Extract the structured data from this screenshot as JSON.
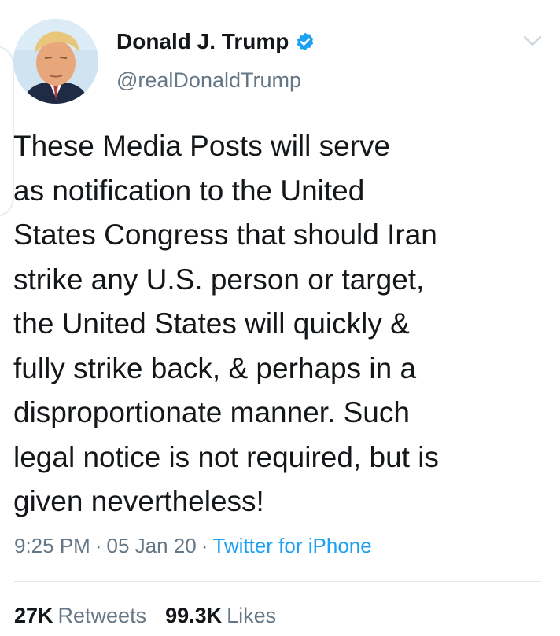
{
  "author": {
    "display_name": "Donald J. Trump",
    "handle": "@realDonaldTrump",
    "verified_icon": "verified-badge-icon",
    "avatar_icon": "profile-photo",
    "more_icon": "chevron-down-icon"
  },
  "tweet": {
    "text": "These Media Posts will serve\nas notification to the United\nStates Congress that should Iran\nstrike any U.S. person or target,\nthe United States will quickly &\nfully strike back, & perhaps in a\ndisproportionate manner. Such\nlegal notice is not required, but is\ngiven nevertheless!"
  },
  "meta": {
    "time": "9:25 PM",
    "separator": "·",
    "date": "05 Jan 20",
    "source": "Twitter for iPhone"
  },
  "stats": {
    "retweets_count": "27K",
    "retweets_label": "Retweets",
    "likes_count": "99.3K",
    "likes_label": "Likes"
  },
  "colors": {
    "text_primary": "#14171a",
    "text_secondary": "#657786",
    "accent": "#1da1f2",
    "divider": "#e1e8ed"
  }
}
